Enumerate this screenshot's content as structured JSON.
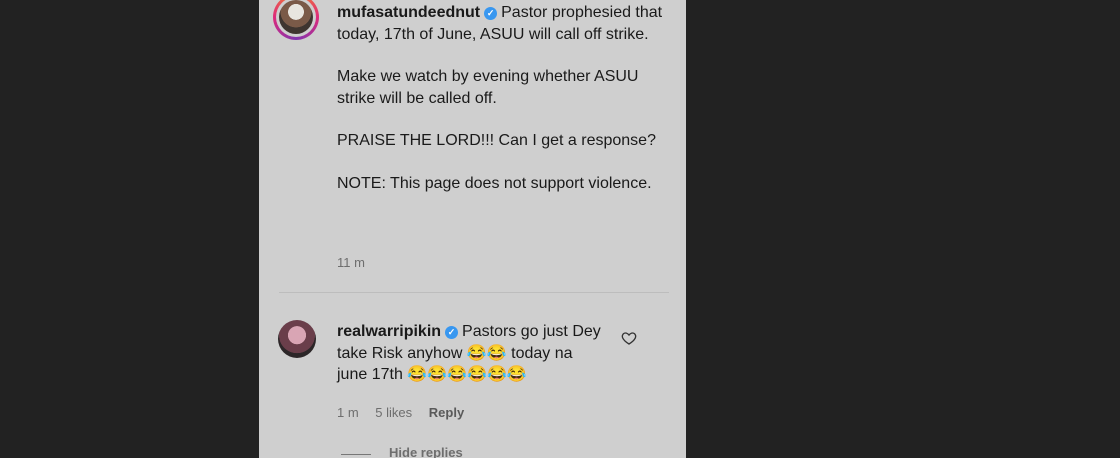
{
  "comment1": {
    "username": "mufasatundeednut",
    "paragraphs": [
      "Pastor prophesied that today, 17th of June, ASUU will call off strike.",
      "Make we watch by evening whether ASUU strike will be called off.",
      "PRAISE THE LORD!!! Can I get a response?",
      "NOTE: This page does not support violence."
    ],
    "time": "11 m"
  },
  "comment2": {
    "username": "realwarripikin",
    "text": "Pastors go just Dey take Risk anyhow 😂😂 today na june 17th 😂😂😂😂😂😂",
    "time": "1 m",
    "likes": "5 likes",
    "reply_label": "Reply",
    "hide_replies_label": "Hide replies"
  },
  "icons": {
    "verified": "verified-badge-icon",
    "like": "heart-icon"
  },
  "colors": {
    "background": "#222222",
    "panel": "#cfcfcf",
    "verified": "#3897f0"
  }
}
